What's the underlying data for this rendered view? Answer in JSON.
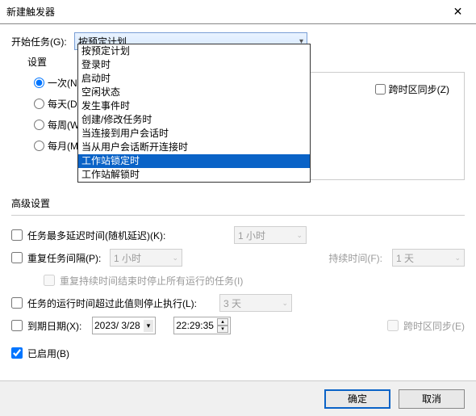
{
  "title": "新建触发器",
  "begin_label": "开始任务(G):",
  "combo_selected": "按预定计划",
  "settings_label": "设置",
  "radios": {
    "once": "一次(N)",
    "daily": "每天(D)",
    "weekly": "每周(W)",
    "monthly": "每月(M)"
  },
  "sync_label": "跨时区同步(Z)",
  "dropdown": {
    "opt0": "按预定计划",
    "opt1": "登录时",
    "opt2": "启动时",
    "opt3": "空闲状态",
    "opt4": "发生事件时",
    "opt5": "创建/修改任务时",
    "opt6": "当连接到用户会话时",
    "opt7": "当从用户会话断开连接时",
    "opt8": "工作站锁定时",
    "opt9": "工作站解锁时"
  },
  "adv_title": "高级设置",
  "adv": {
    "delay_label": "任务最多延迟时间(随机延迟)(K):",
    "delay_val": "1 小时",
    "repeat_label": "重复任务间隔(P):",
    "repeat_val": "1 小时",
    "duration_label": "持续时间(F):",
    "duration_val": "1 天",
    "stop_all_label": "重复持续时间结束时停止所有运行的任务(I)",
    "stop_after_label": "任务的运行时间超过此值则停止执行(L):",
    "stop_after_val": "3 天",
    "expire_label": "到期日期(X):",
    "expire_date": "2023/ 3/28",
    "expire_time": "22:29:35",
    "expire_sync": "跨时区同步(E)",
    "enabled_label": "已启用(B)"
  },
  "buttons": {
    "ok": "确定",
    "cancel": "取消"
  }
}
